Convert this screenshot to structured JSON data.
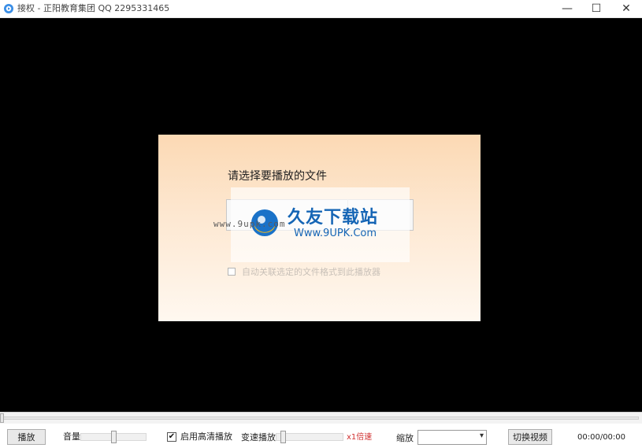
{
  "window": {
    "title": "接权 - 正阳教育集团 QQ 2295331465",
    "minimize_glyph": "—",
    "maximize_glyph": "☐",
    "close_glyph": "✕"
  },
  "open_panel": {
    "prompt": "请选择要播放的文件",
    "auto_associate_label": "自动关联选定的文件格式到此播放器",
    "auto_associate_checked": false
  },
  "watermark": {
    "title": "久友下载站",
    "url": "Www.9UPK.Com",
    "url_left": "www.9upk.com"
  },
  "seek": {
    "progress": 0
  },
  "controls": {
    "play_label": "播放",
    "volume_label": "音量",
    "volume_level": 0.5,
    "hd_label": "启用高清播放",
    "hd_checked": true,
    "check_glyph": "✔",
    "speed_label": "变速播放",
    "speed_level": 0.08,
    "speed_value": "x1倍速",
    "zoom_label": "缩放",
    "zoom_value": "",
    "dropdown_glyph": "▾",
    "switch_label": "切换视频",
    "time": "00:00/00:00"
  },
  "colors": {
    "video_bg": "#000000",
    "speed_value": "#d03030",
    "watermark_blue": "#1565b5"
  }
}
